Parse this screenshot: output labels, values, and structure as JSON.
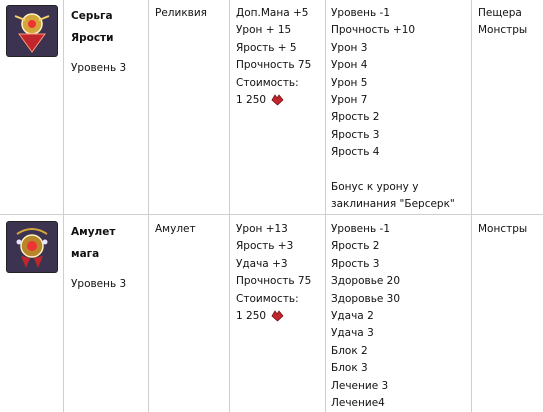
{
  "rows": [
    {
      "name_lines": [
        "Серьга",
        "Ярости"
      ],
      "level": "Уровень 3",
      "type": "Реликвия",
      "stats": [
        "Доп.Мана +5",
        "Урон + 15",
        "Ярость + 5",
        "Прочность 75",
        "Стоимость:"
      ],
      "price": "1 250",
      "requirements": [
        "Уровень -1",
        "Прочность +10",
        "Урон 3",
        "Урон 4",
        "Урон 5",
        "Урон 7",
        "Ярость 2",
        "Ярость 3",
        "Ярость 4"
      ],
      "bonus_lines": [
        "Бонус к урону у",
        "заклинания \"Берсерк\""
      ],
      "location_lines": [
        "Пещера",
        "Монстры"
      ]
    },
    {
      "name_lines": [
        "Амулет",
        "мага"
      ],
      "level": "Уровень 3",
      "type": "Амулет",
      "stats": [
        "Урон +13",
        "Ярость +3",
        "Удача +3",
        "Прочность 75",
        "Стоимость:"
      ],
      "price": "1 250",
      "requirements": [
        "Уровень -1",
        "Ярость 2",
        "Ярость 3",
        "Здоровье 20",
        "Здоровье 30",
        "Удача 2",
        "Удача 3",
        "Блок 2",
        "Блок 3",
        "Лечение 3",
        "Лечение4"
      ],
      "bonus_lines": [],
      "location_lines": [
        "Монстры"
      ]
    }
  ],
  "colors": {
    "grid": "#cfcfcf",
    "gem": "#c0262b",
    "icon_bg": "#4a3a5c"
  }
}
